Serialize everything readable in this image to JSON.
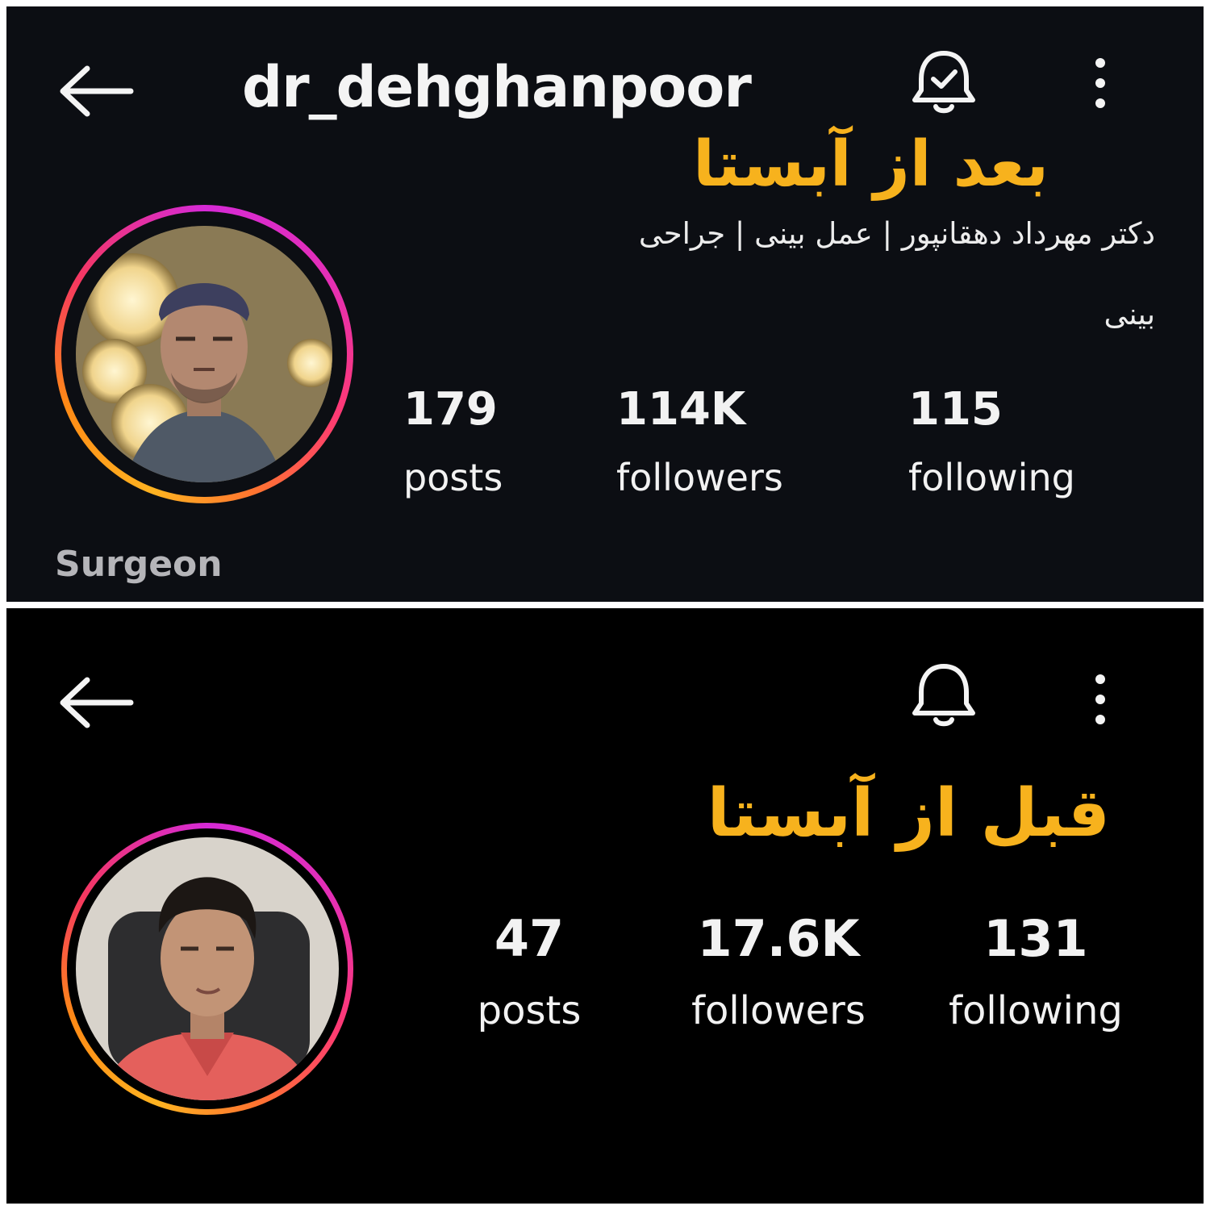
{
  "after": {
    "username": "dr_dehghanpoor",
    "caption": "بعد از آبستا",
    "bio_line1": "دکتر مهرداد دهقانپور | عمل بینی | جراحی",
    "bio_line2": "بینی",
    "stats": [
      {
        "value": "179",
        "label": "posts"
      },
      {
        "value": "114K",
        "label": "followers"
      },
      {
        "value": "115",
        "label": "following"
      }
    ],
    "occupation": "Surgeon"
  },
  "before": {
    "caption": "قبل از آبستا",
    "stats": [
      {
        "value": "47",
        "label": "posts"
      },
      {
        "value": "17.6K",
        "label": "followers"
      },
      {
        "value": "131",
        "label": "following"
      }
    ]
  },
  "icons": {
    "back": "arrow-left-icon",
    "notifications_on": "bell-check-icon",
    "notifications_off": "bell-icon",
    "more": "more-vertical-icon"
  },
  "colors": {
    "caption": "#f7b21d",
    "top_background": "#0c0e13",
    "bottom_background": "#000000",
    "story_ring": "#d62ad6"
  }
}
